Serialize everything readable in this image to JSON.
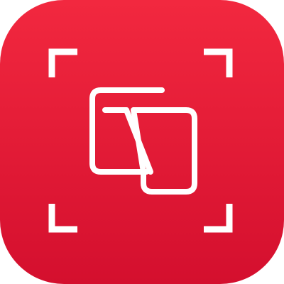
{
  "app_icon": {
    "icon_name": "scanner-app-icon",
    "depicts": [
      "viewfinder-corners-icon",
      "overlapping-cards-icon"
    ],
    "colors": {
      "background_top": "#F2283F",
      "background_bottom": "#D40F2E",
      "glyph": "#FFFFFF"
    }
  }
}
